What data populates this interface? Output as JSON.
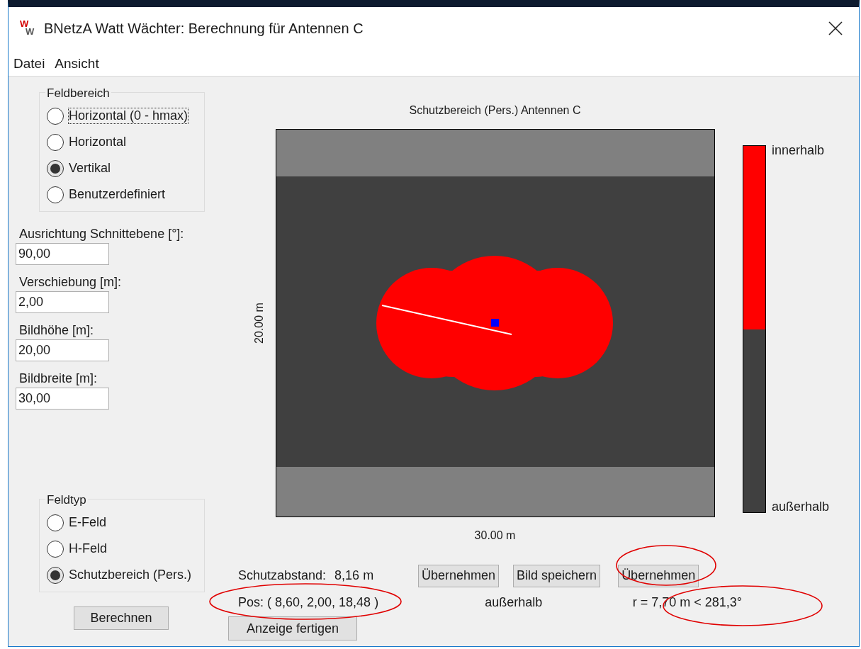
{
  "window": {
    "title": "BNetzA Watt Wächter: Berechnung für Antennen C",
    "icon_letters": [
      "W",
      "W"
    ]
  },
  "menu": [
    "Datei",
    "Ansicht"
  ],
  "feldbereich": {
    "title": "Feldbereich",
    "options": [
      {
        "label": "Horizontal (0 - hmax)",
        "selected": false,
        "focused": true
      },
      {
        "label": "Horizontal",
        "selected": false,
        "focused": false
      },
      {
        "label": "Vertikal",
        "selected": true,
        "focused": false
      },
      {
        "label": "Benutzerdefiniert",
        "selected": false,
        "focused": false
      }
    ]
  },
  "fields": [
    {
      "label": "Ausrichtung Schnittebene [°]:",
      "value": "90,00"
    },
    {
      "label": "Verschiebung [m]:",
      "value": "2,00"
    },
    {
      "label": "Bildhöhe [m]:",
      "value": "20,00"
    },
    {
      "label": "Bildbreite [m]:",
      "value": "30,00"
    }
  ],
  "feldtyp": {
    "title": "Feldtyp",
    "options": [
      {
        "label": "E-Feld",
        "selected": false,
        "focused": false
      },
      {
        "label": "H-Feld",
        "selected": false,
        "focused": false
      },
      {
        "label": "Schutzbereich (Pers.)",
        "selected": true,
        "focused": false
      }
    ]
  },
  "calculate_button": "Berechnen",
  "plot": {
    "title": "Schutzbereich (Pers.) Antennen C",
    "ylabel": "20.00 m",
    "xlabel": "30.00 m"
  },
  "legend": {
    "top_label": "innerhalb",
    "bottom_label": "außerhalb",
    "level": 0.5
  },
  "results": {
    "distance_label": "Schutzabstand:",
    "distance_value": "8,16 m",
    "position": "Pos: ( 8,60, 2,00, 18,48 )",
    "location": "außerhalb",
    "polar": "r = 7,70 m < 281,3°"
  },
  "buttons": [
    "Übernehmen",
    "Bild speichern",
    "Übernehmen"
  ],
  "display_button": "Anzeige fertigen"
}
